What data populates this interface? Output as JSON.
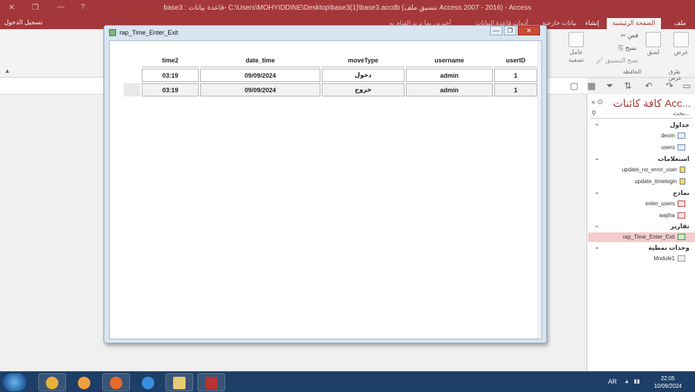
{
  "window": {
    "title": "base3 : قاعدة بيانات- C:\\Users\\MOHYIDDINE\\Desktop\\base3(1)\\base3.accdb (تنسيق ملف Access 2007 - 2016) - Access",
    "help": "?",
    "minimize": "—",
    "restore": "❐",
    "close": "✕"
  },
  "ribbon": {
    "signin": "تسجيل الدخول",
    "tabs": [
      {
        "label": "ملف"
      },
      {
        "label": "الصفحة الرئيسية"
      },
      {
        "label": "إنشاء"
      },
      {
        "label": "بيانات خارجية"
      },
      {
        "label": "أدوات قاعدة البيانات"
      },
      {
        "label": "أخبرني بما تريد القيام به"
      }
    ],
    "view_label": "عرض",
    "paste_label": "لصق",
    "cut_label": "قص",
    "copy_label": "نسخ",
    "format_painter_label": "نسخ التنسيق",
    "filter_label": "عامل تصفية",
    "group_views": "طرق عرض",
    "group_clipboard": "الحافظة"
  },
  "nav": {
    "header": "كافة كائنات Acc...",
    "search_placeholder": "بحث...",
    "sections": [
      {
        "label": "جداول",
        "items": [
          {
            "label": "deom"
          },
          {
            "label": "users"
          }
        ]
      },
      {
        "label": "استعلامات",
        "items": [
          {
            "label": "update_no_error_user"
          },
          {
            "label": "update_timelogin"
          }
        ]
      },
      {
        "label": "نماذج",
        "items": [
          {
            "label": "enter_users"
          },
          {
            "label": "wajiha"
          }
        ]
      },
      {
        "label": "تقارير",
        "items": [
          {
            "label": "rap_Time_Enter_Exit"
          }
        ]
      },
      {
        "label": "وحدات نمطية",
        "items": [
          {
            "label": "Module1"
          }
        ]
      }
    ]
  },
  "report": {
    "title": "rap_Time_Enter_Exit",
    "columns": [
      "time2",
      "date_time",
      "moveType",
      "username",
      "userID"
    ],
    "rows": [
      [
        "03:19",
        "09/09/2024",
        "دخول",
        "admin",
        "1"
      ],
      [
        "03:19",
        "09/09/2024",
        "خروج",
        "admin",
        "1"
      ]
    ]
  },
  "taskbar": {
    "apps": [
      {
        "icon": "chrome-icon",
        "color": "#e8b23a"
      },
      {
        "icon": "media-player-icon",
        "color": "#f0a040"
      },
      {
        "icon": "firefox-icon",
        "color": "#e86a2a"
      },
      {
        "icon": "internet-explorer-icon",
        "color": "#3a8ee0"
      },
      {
        "icon": "file-explorer-icon",
        "color": "#e8c870"
      },
      {
        "icon": "access-icon",
        "color": "#b83232"
      }
    ],
    "lang": "AR",
    "time": "22:05",
    "date": "10/09/2024"
  }
}
